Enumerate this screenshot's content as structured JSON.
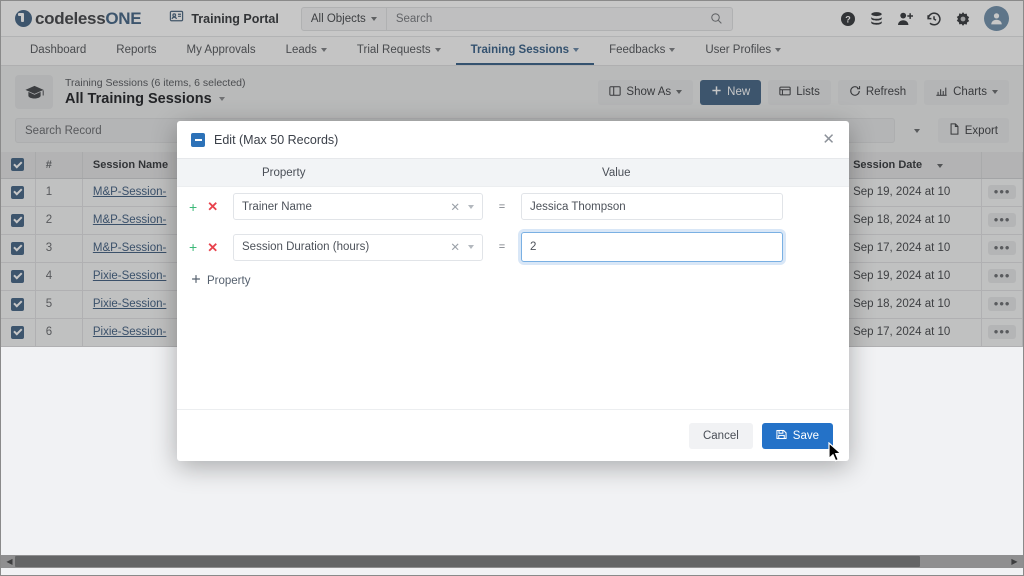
{
  "topbar": {
    "logo": {
      "part1": "codeless",
      "part2": "ONE",
      "icon": "codeless-logo-icon"
    },
    "portal_label": "Training Portal",
    "portal_icon": "portal-screen-icon",
    "object_selector": "All Objects",
    "search_placeholder": "Search",
    "search_value": "",
    "icons": [
      "help-icon",
      "database-icon",
      "add-user-icon",
      "history-icon",
      "gear-icon",
      "avatar"
    ]
  },
  "nav": {
    "tabs": [
      {
        "label": "Dashboard",
        "caret": false,
        "active": false
      },
      {
        "label": "Reports",
        "caret": false,
        "active": false
      },
      {
        "label": "My Approvals",
        "caret": false,
        "active": false
      },
      {
        "label": "Leads",
        "caret": true,
        "active": false
      },
      {
        "label": "Trial Requests",
        "caret": true,
        "active": false
      },
      {
        "label": "Training Sessions",
        "caret": true,
        "active": true
      },
      {
        "label": "Feedbacks",
        "caret": true,
        "active": false
      },
      {
        "label": "User Profiles",
        "caret": true,
        "active": false
      }
    ]
  },
  "listheader": {
    "icon": "graduation-cap-icon",
    "subtitle": "Training Sessions (6 items, 6 selected)",
    "title": "All Training Sessions",
    "buttons": [
      {
        "label": "Show As",
        "icon": "layout-icon",
        "caret": true,
        "primary": false
      },
      {
        "label": "New",
        "icon": "plus-icon",
        "caret": false,
        "primary": true
      },
      {
        "label": "Lists",
        "icon": "list-icon",
        "caret": false,
        "primary": false
      },
      {
        "label": "Refresh",
        "icon": "refresh-icon",
        "caret": false,
        "primary": false
      },
      {
        "label": "Charts",
        "icon": "chart-icon",
        "caret": true,
        "primary": false
      }
    ],
    "search_record_placeholder": "Search Record",
    "export_label": "Export",
    "export_icon": "export-file-icon"
  },
  "table": {
    "columns": [
      "",
      "#",
      "Session Name",
      "",
      "Session Date",
      ""
    ],
    "rows": [
      {
        "num": "1",
        "name": "M&P-Session-",
        "date": "Sep 19, 2024 at 10",
        "checked": true
      },
      {
        "num": "2",
        "name": "M&P-Session-",
        "date": "Sep 18, 2024 at 10",
        "checked": true
      },
      {
        "num": "3",
        "name": "M&P-Session-",
        "date": "Sep 17, 2024 at 10",
        "checked": true
      },
      {
        "num": "4",
        "name": "Pixie-Session-",
        "date": "Sep 19, 2024 at 10",
        "checked": true
      },
      {
        "num": "5",
        "name": "Pixie-Session-",
        "date": "Sep 18, 2024 at 10",
        "checked": true
      },
      {
        "num": "6",
        "name": "Pixie-Session-",
        "date": "Sep 17, 2024 at 10",
        "checked": true
      }
    ],
    "row_menu_glyph": "•••"
  },
  "modal": {
    "title": "Edit (Max 50 Records)",
    "minimize_icon": "minimize-icon",
    "close_icon": "close-icon",
    "col_property": "Property",
    "col_value": "Value",
    "equals": "=",
    "rows": [
      {
        "property": "Trainer Name",
        "value": "Jessica Thompson",
        "focused": false
      },
      {
        "property": "Session Duration (hours)",
        "value": "2",
        "focused": true
      }
    ],
    "add_property_label": "Property",
    "add_property_icon": "plus-icon",
    "cancel_label": "Cancel",
    "save_label": "Save",
    "save_icon": "save-disk-icon"
  },
  "colors": {
    "accent": "#2d72b8",
    "save_button": "#2472c8",
    "link": "#2d6cb5",
    "add_row": "#3cb878",
    "remove_row": "#e8424c",
    "focus_ring": "#7ab0e3"
  }
}
